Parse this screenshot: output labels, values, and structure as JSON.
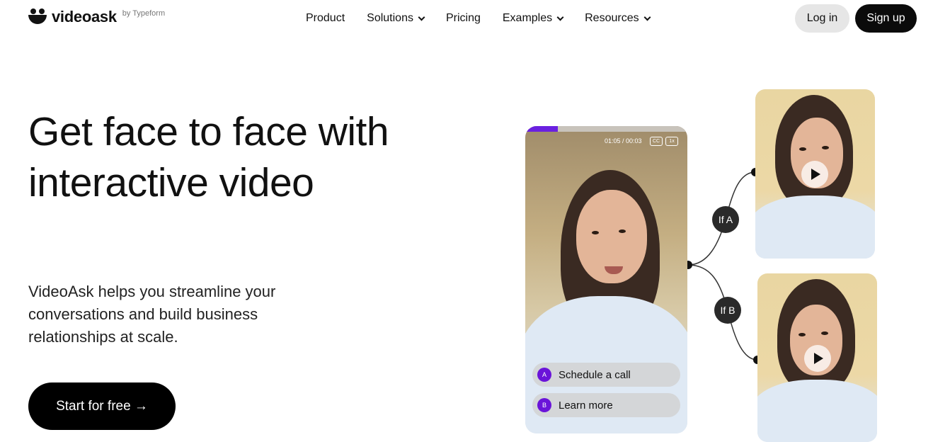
{
  "brand": {
    "name": "videoask",
    "byline": "by Typeform"
  },
  "nav": {
    "items": [
      {
        "label": "Product",
        "has_menu": false
      },
      {
        "label": "Solutions",
        "has_menu": true
      },
      {
        "label": "Pricing",
        "has_menu": false
      },
      {
        "label": "Examples",
        "has_menu": true
      },
      {
        "label": "Resources",
        "has_menu": true
      }
    ],
    "login_label": "Log in",
    "signup_label": "Sign up"
  },
  "hero": {
    "title": "Get face to face with interactive video",
    "subtitle": "VideoAsk helps you streamline your conversations and build business relationships at scale.",
    "cta_label": "Start for free →"
  },
  "player": {
    "progress": 0.2,
    "time": "01:05 / 00:03",
    "cc_label": "CC",
    "speed_label": "1x",
    "options": [
      {
        "key": "A",
        "label": "Schedule a call"
      },
      {
        "key": "B",
        "label": "Learn more"
      }
    ]
  },
  "branches": [
    {
      "label": "If A"
    },
    {
      "label": "If B"
    }
  ],
  "colors": {
    "accent": "#6a14d9",
    "primary_button": "#0b0b0b",
    "secondary_button": "#e6e6e6"
  },
  "icons": {
    "play": "play-icon",
    "chevron": "chevron-down-icon",
    "logo": "videoask-logo-icon"
  }
}
